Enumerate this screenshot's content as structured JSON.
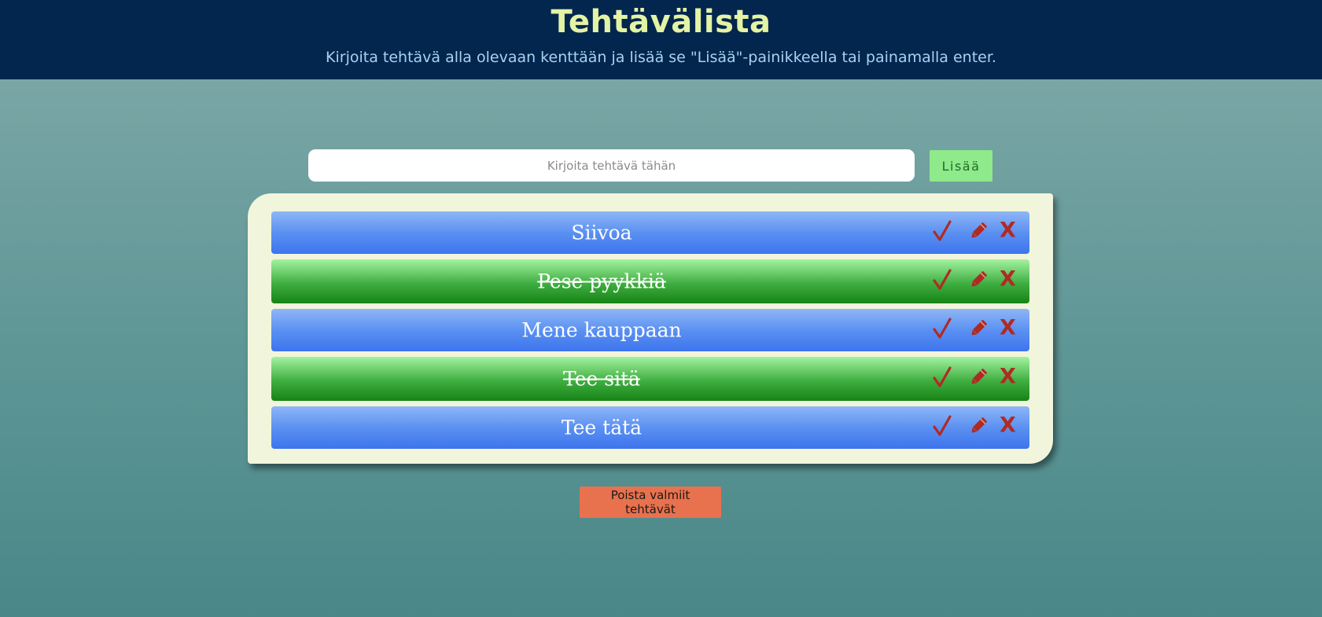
{
  "header": {
    "title": "Tehtävälista",
    "subtitle": "Kirjoita tehtävä alla olevaan kenttään ja lisää se \"Lisää\"-painikkeella tai painamalla enter."
  },
  "input": {
    "placeholder": "Kirjoita tehtävä tähän",
    "value": ""
  },
  "add_button": {
    "label": "Lisää"
  },
  "tasks": [
    {
      "text": "Siivoa",
      "done": false
    },
    {
      "text": "Pese pyykkiä",
      "done": true
    },
    {
      "text": "Mene kauppaan",
      "done": false
    },
    {
      "text": "Tee sitä",
      "done": true
    },
    {
      "text": "Tee tätä",
      "done": false
    }
  ],
  "task_actions": {
    "complete_icon": "check-icon",
    "edit_icon": "pencil-icon",
    "delete_icon": "close-icon",
    "delete_label": "X"
  },
  "clear_button": {
    "label": "Poista valmiit tehtävät"
  },
  "colors": {
    "header_bg": "#03264f",
    "title": "#e4f3a4",
    "subtitle": "#a7d3ee",
    "task_open": "#5b91f1",
    "task_done": "#168316",
    "icon": "#b02a24",
    "add_button_bg": "#8eea8a",
    "clear_button_bg": "#e8714e",
    "panel_bg": "#f1f5db"
  }
}
